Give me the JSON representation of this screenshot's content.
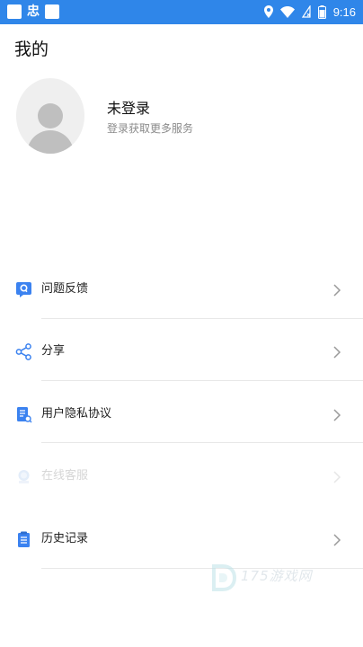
{
  "status_bar": {
    "app_glyph": "忠",
    "time": "9:16"
  },
  "header": {
    "title": "我的"
  },
  "profile": {
    "name": "未登录",
    "hint": "登录获取更多服务"
  },
  "menu": {
    "items": [
      {
        "label": "问题反馈",
        "icon": "feedback-icon"
      },
      {
        "label": "分享",
        "icon": "share-icon"
      },
      {
        "label": "用户隐私协议",
        "icon": "document-icon"
      },
      {
        "label": "在线客服",
        "icon": "customer-service-icon"
      },
      {
        "label": "历史记录",
        "icon": "history-icon"
      }
    ]
  },
  "watermark": {
    "text": "175游戏网"
  },
  "colors": {
    "status_bar": "#2f86e9",
    "icon_blue": "#3b82f0",
    "divider": "#e8e8e8",
    "hint_text": "#8a8a8a"
  }
}
